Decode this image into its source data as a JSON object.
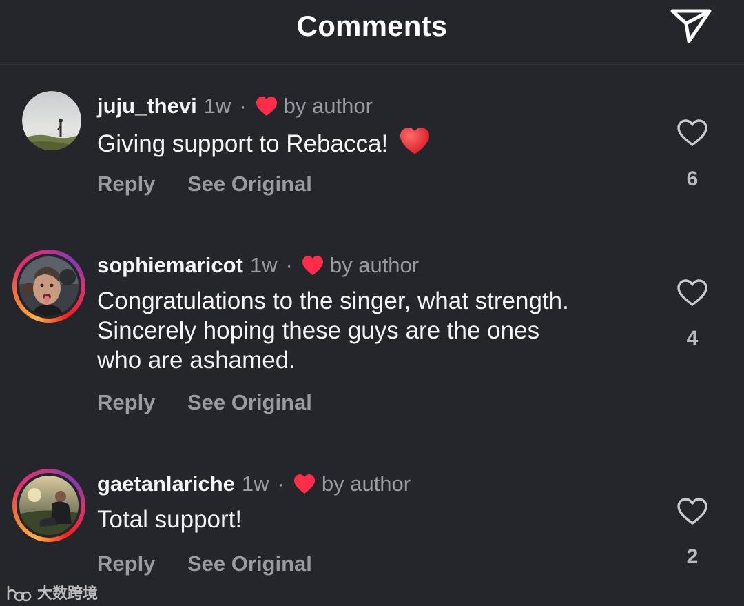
{
  "header": {
    "title": "Comments",
    "share_icon": "paper-plane-icon"
  },
  "colors": {
    "background": "#25262b",
    "secondary_text": "#9a9ba2",
    "heart_red": "#ff2d4a"
  },
  "comments": [
    {
      "username": "juju_thevi",
      "time": "1w",
      "separator": "·",
      "author_badge": "by author",
      "text": "Giving support to Rebacca!",
      "emoji": "red-heart",
      "reply_label": "Reply",
      "see_original_label": "See Original",
      "like_count": "6",
      "story_ring": false
    },
    {
      "username": "sophiemaricot",
      "time": "1w",
      "separator": "·",
      "author_badge": "by author",
      "text_lines": [
        "Congratulations to the singer, what strength.",
        "Sincerely hoping these guys are the ones",
        "who are ashamed."
      ],
      "reply_label": "Reply",
      "see_original_label": "See Original",
      "like_count": "4",
      "story_ring": true
    },
    {
      "username": "gaetanlariche",
      "time": "1w",
      "separator": "·",
      "author_badge": "by author",
      "text": "Total support!",
      "reply_label": "Reply",
      "see_original_label": "See Original",
      "like_count": "2",
      "story_ring": true
    }
  ],
  "watermark": {
    "text": "大数跨境"
  }
}
